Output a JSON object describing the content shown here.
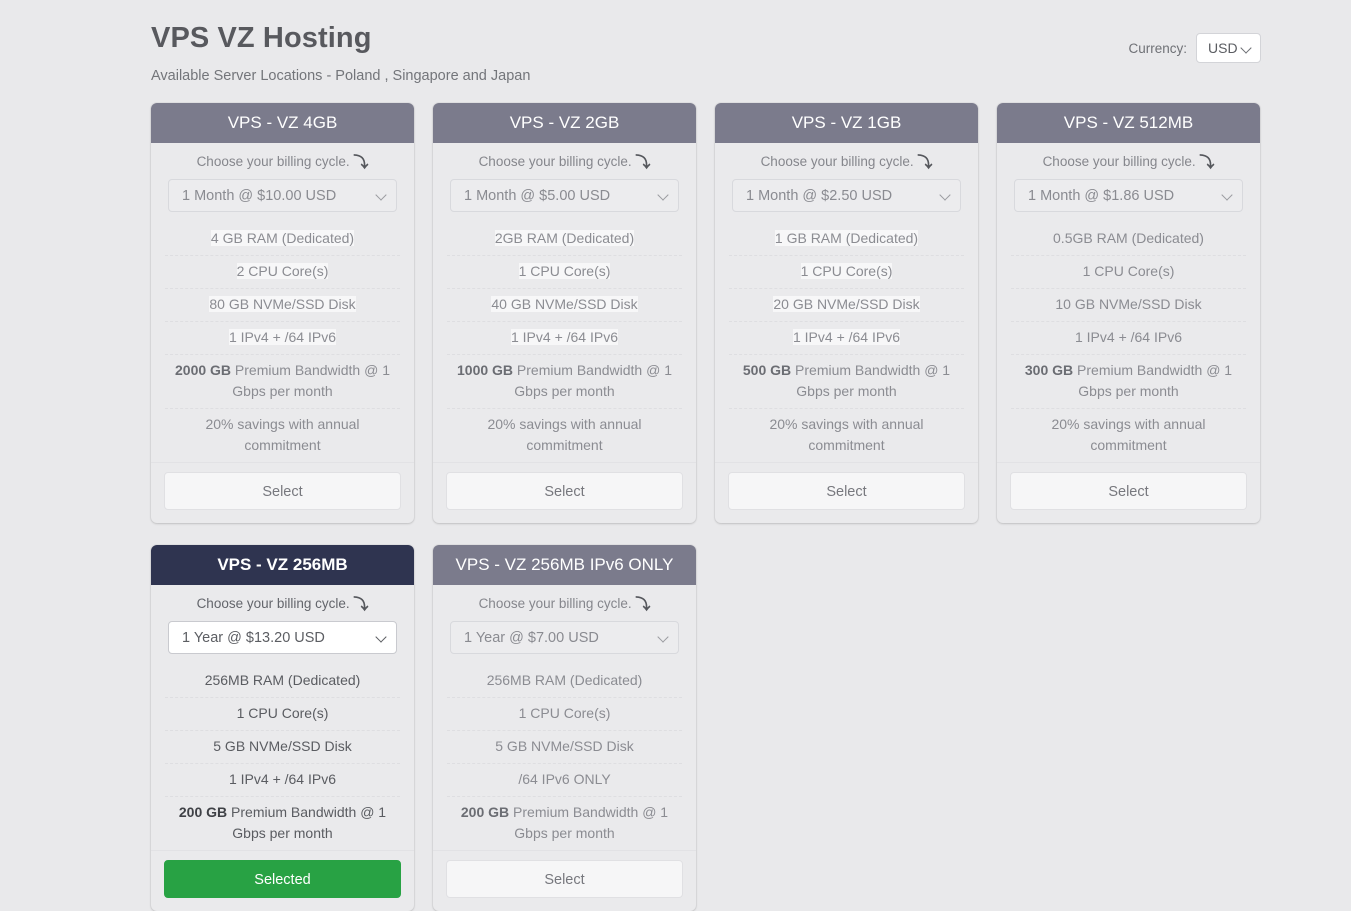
{
  "header": {
    "title": "VPS VZ Hosting",
    "subtitle": "Available Server Locations - Poland , Singapore and Japan",
    "currency_label": "Currency:",
    "currency_value": "USD"
  },
  "labels": {
    "cycle_prompt": "Choose your billing cycle.",
    "cycle_arrow": "⤵",
    "select": "Select",
    "selected": "Selected"
  },
  "colors": {
    "page_bg": "#e9e9eb",
    "card_header": "#7b7b8c",
    "card_header_selected": "#2f3450",
    "selected_button": "#28a244"
  },
  "plans": [
    {
      "name": "VPS - VZ 4GB",
      "cycle": "1 Month @ $10.00 USD",
      "selected": false,
      "button": "Select",
      "features": [
        {
          "text": "4 GB RAM (Dedicated)",
          "highlight": true
        },
        {
          "text": "2 CPU Core(s)",
          "highlight": true
        },
        {
          "text": "80 GB NVMe/SSD Disk",
          "highlight": true
        },
        {
          "text": "1 IPv4 + /64 IPv6",
          "highlight": true
        },
        {
          "bold": "2000 GB",
          "text": " Premium Bandwidth @ 1 Gbps per month"
        },
        {
          "text": "20% savings with annual commitment"
        }
      ]
    },
    {
      "name": "VPS - VZ 2GB",
      "cycle": "1 Month @ $5.00 USD",
      "selected": false,
      "button": "Select",
      "features": [
        {
          "text": "2GB RAM (Dedicated)",
          "highlight": true
        },
        {
          "text": "1 CPU Core(s)",
          "highlight": true
        },
        {
          "text": "40 GB NVMe/SSD Disk",
          "highlight": true
        },
        {
          "text": "1 IPv4 + /64 IPv6",
          "highlight": true
        },
        {
          "bold": "1000 GB",
          "text": " Premium Bandwidth @ 1 Gbps per month"
        },
        {
          "text": "20% savings with annual commitment"
        }
      ]
    },
    {
      "name": "VPS - VZ 1GB",
      "cycle": "1 Month @ $2.50 USD",
      "selected": false,
      "button": "Select",
      "features": [
        {
          "text": "1 GB RAM (Dedicated)",
          "highlight": true
        },
        {
          "text": "1 CPU Core(s)",
          "highlight": true
        },
        {
          "text": "20 GB NVMe/SSD Disk",
          "highlight": true
        },
        {
          "text": "1 IPv4 + /64 IPv6",
          "highlight": true
        },
        {
          "bold": "500 GB",
          "text": " Premium Bandwidth @ 1 Gbps per month"
        },
        {
          "text": "20% savings with annual commitment"
        }
      ]
    },
    {
      "name": "VPS - VZ 512MB",
      "cycle": "1 Month @ $1.86 USD",
      "selected": false,
      "button": "Select",
      "features": [
        {
          "text": "0.5GB RAM (Dedicated)"
        },
        {
          "text": "1 CPU Core(s)"
        },
        {
          "text": "10 GB NVMe/SSD Disk"
        },
        {
          "text": "1 IPv4 + /64 IPv6"
        },
        {
          "bold": "300 GB",
          "text": " Premium Bandwidth @ 1 Gbps per month"
        },
        {
          "text": "20% savings with annual commitment"
        }
      ]
    },
    {
      "name": "VPS - VZ 256MB",
      "cycle": "1 Year @ $13.20 USD",
      "selected": true,
      "button": "Selected",
      "features": [
        {
          "text": "256MB RAM (Dedicated)"
        },
        {
          "text": "1 CPU Core(s)"
        },
        {
          "text": "5 GB NVMe/SSD Disk"
        },
        {
          "text": "1 IPv4 + /64 IPv6"
        },
        {
          "bold": "200 GB",
          "text": " Premium Bandwidth @ 1 Gbps per month"
        }
      ]
    },
    {
      "name": "VPS - VZ 256MB IPv6 ONLY",
      "cycle": "1 Year @ $7.00 USD",
      "selected": false,
      "button": "Select",
      "features": [
        {
          "text": "256MB RAM (Dedicated)"
        },
        {
          "text": "1 CPU Core(s)"
        },
        {
          "text": "5 GB NVMe/SSD Disk"
        },
        {
          "text": "/64 IPv6 ONLY"
        },
        {
          "bold": "200 GB",
          "text": " Premium Bandwidth @ 1 Gbps per month"
        }
      ]
    }
  ]
}
